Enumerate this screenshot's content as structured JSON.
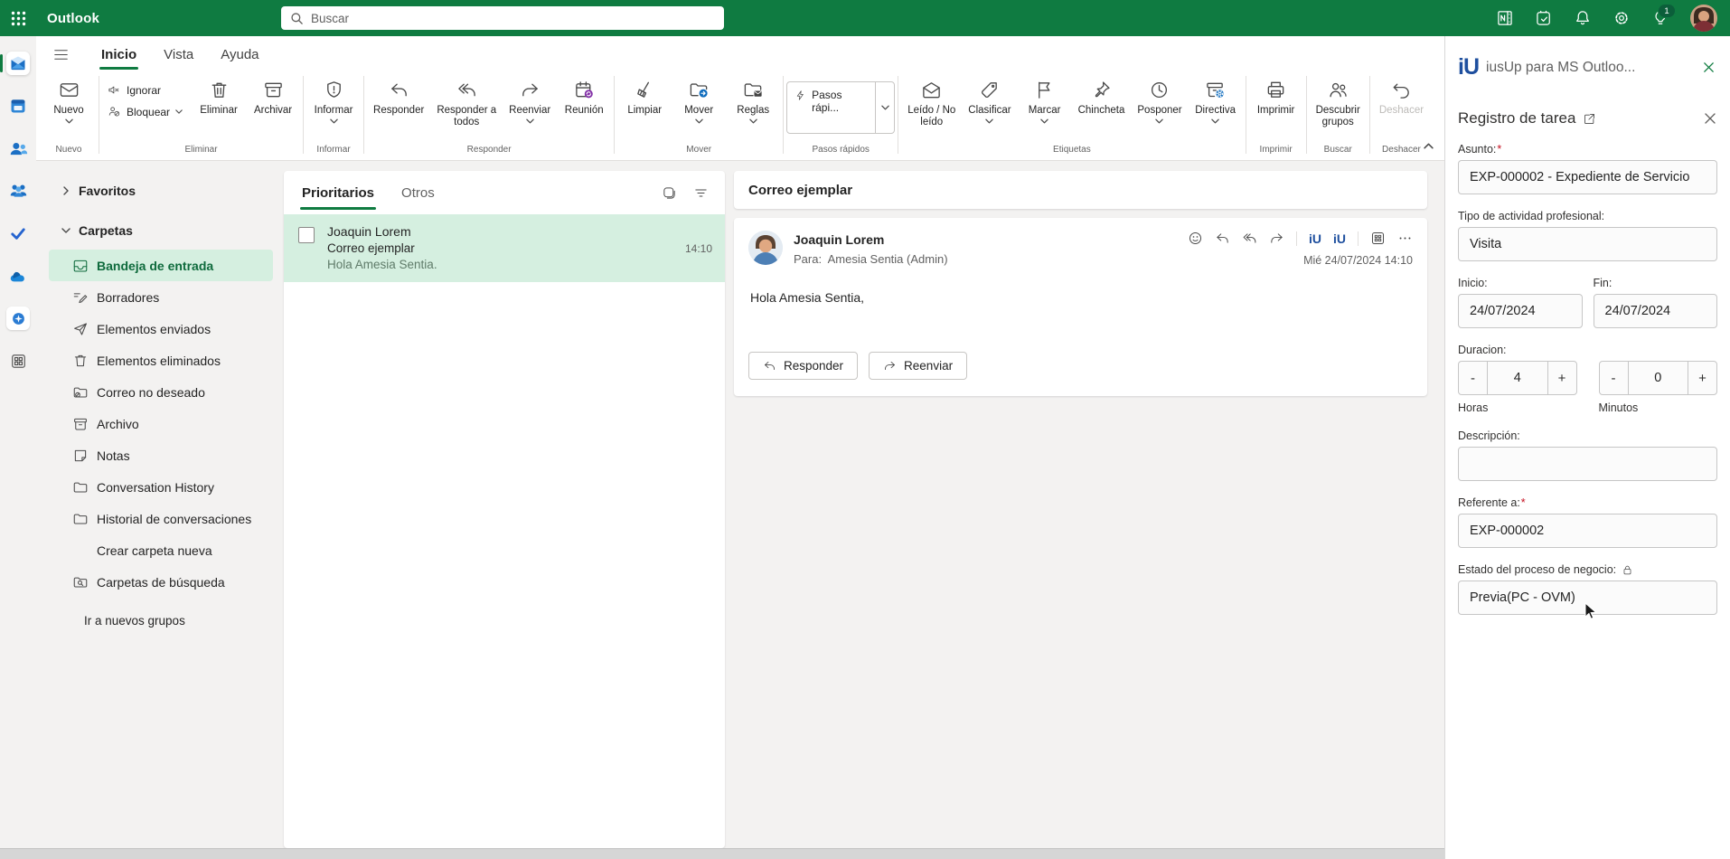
{
  "colors": {
    "brand_green": "#0F7B41",
    "mint_selection": "#D5EFE0",
    "accent_blue": "#0F6CBD",
    "reply_purple": "#8331A7",
    "alert_red": "#A4262C",
    "logo_blue": "#1E4F9E"
  },
  "topbar": {
    "app_name": "Outlook",
    "search_placeholder": "Buscar",
    "tips_badge": "1"
  },
  "menu_tabs": {
    "inicio": "Inicio",
    "vista": "Vista",
    "ayuda": "Ayuda"
  },
  "ribbon": {
    "nuevo": "Nuevo",
    "ignorar": "Ignorar",
    "bloquear": "Bloquear",
    "eliminar": "Eliminar",
    "archivar": "Archivar",
    "informar": "Informar",
    "responder": "Responder",
    "responder_a_todos": "Responder a\ntodos",
    "reenviar": "Reenviar",
    "reunion": "Reunión",
    "limpiar": "Limpiar",
    "mover": "Mover",
    "reglas": "Reglas",
    "pasos_rapidos": "Pasos rápi...",
    "leido_no_leido": "Leído / No\nleído",
    "clasificar": "Clasificar",
    "marcar": "Marcar",
    "chincheta": "Chincheta",
    "posponer": "Posponer",
    "directiva": "Directiva",
    "imprimir": "Imprimir",
    "descubrir_grupos": "Descubrir\ngrupos",
    "deshacer": "Deshacer",
    "group_labels": {
      "nuevo": "Nuevo",
      "eliminar": "Eliminar",
      "informar": "Informar",
      "responder": "Responder",
      "mover": "Mover",
      "pasos_rapidos": "Pasos rápidos",
      "etiquetas": "Etiquetas",
      "imprimir": "Imprimir",
      "buscar": "Buscar",
      "deshacer": "Deshacer"
    }
  },
  "folder_pane": {
    "favoritos": "Favoritos",
    "carpetas": "Carpetas",
    "items": [
      {
        "label": "Bandeja de entrada",
        "icon": "inbox-icon",
        "selected": true
      },
      {
        "label": "Borradores",
        "icon": "drafts-icon"
      },
      {
        "label": "Elementos enviados",
        "icon": "sent-icon"
      },
      {
        "label": "Elementos eliminados",
        "icon": "trash-icon"
      },
      {
        "label": "Correo no deseado",
        "icon": "junk-folder-icon"
      },
      {
        "label": "Archivo",
        "icon": "archive-icon"
      },
      {
        "label": "Notas",
        "icon": "notes-icon"
      },
      {
        "label": "Conversation History",
        "icon": "folder-icon"
      },
      {
        "label": "Historial de conversaciones",
        "icon": "folder-icon"
      },
      {
        "label": "Crear carpeta nueva",
        "icon": null
      },
      {
        "label": "Carpetas de búsqueda",
        "icon": "search-folder-icon"
      }
    ],
    "footer_link": "Ir a nuevos grupos"
  },
  "message_list": {
    "tabs": {
      "prioritarios": "Prioritarios",
      "otros": "Otros"
    },
    "items": [
      {
        "sender": "Joaquin Lorem",
        "subject": "Correo ejemplar",
        "preview": "Hola Amesia Sentia.",
        "time": "14:10",
        "selected": true
      }
    ]
  },
  "reading_pane": {
    "subject": "Correo ejemplar",
    "message": {
      "sender": "Joaquin Lorem",
      "to_label": "Para:",
      "recipient": "Amesia Sentia (Admin)",
      "date": "Mié 24/07/2024 14:10",
      "body": "Hola Amesia Sentia,"
    },
    "actions": {
      "responder": "Responder",
      "reenviar": "Reenviar"
    }
  },
  "addin_panel": {
    "logo_text": "iU",
    "title": "iusUp para MS Outloo...",
    "form_title": "Registro de tarea",
    "fields": {
      "asunto": {
        "label": "Asunto:",
        "required": "*",
        "value": "EXP-000002 - Expediente de Servicio"
      },
      "tipo_actividad": {
        "label": "Tipo de actividad profesional:",
        "value": "Visita"
      },
      "inicio": {
        "label": "Inicio:",
        "value": "24/07/2024"
      },
      "fin": {
        "label": "Fin:",
        "value": "24/07/2024"
      },
      "duracion": {
        "label": "Duracion:",
        "horas": {
          "minus": "-",
          "value": "4",
          "plus": "+",
          "unit": "Horas"
        },
        "minutos": {
          "minus": "-",
          "value": "0",
          "plus": "+",
          "unit": "Minutos"
        }
      },
      "descripcion": {
        "label": "Descripción:",
        "value": ""
      },
      "referente": {
        "label": "Referente a:",
        "required": "*",
        "value": "EXP-000002"
      },
      "estado": {
        "label": "Estado del proceso de negocio:",
        "value": "Previa(PC - OVM)"
      }
    }
  }
}
